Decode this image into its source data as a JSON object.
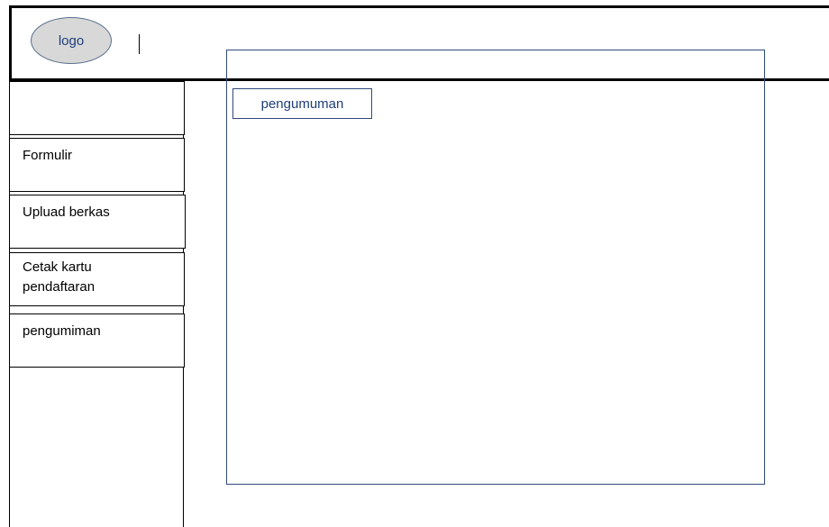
{
  "header": {
    "logo_label": "logo"
  },
  "content": {
    "announcement_label": "pengumuman"
  },
  "sidebar": {
    "items": [
      {
        "label": ""
      },
      {
        "label": "Formulir"
      },
      {
        "label": "Upluad berkas"
      },
      {
        "label": "Cetak kartu pendaftaran"
      },
      {
        "label": "pengumiman"
      }
    ]
  }
}
